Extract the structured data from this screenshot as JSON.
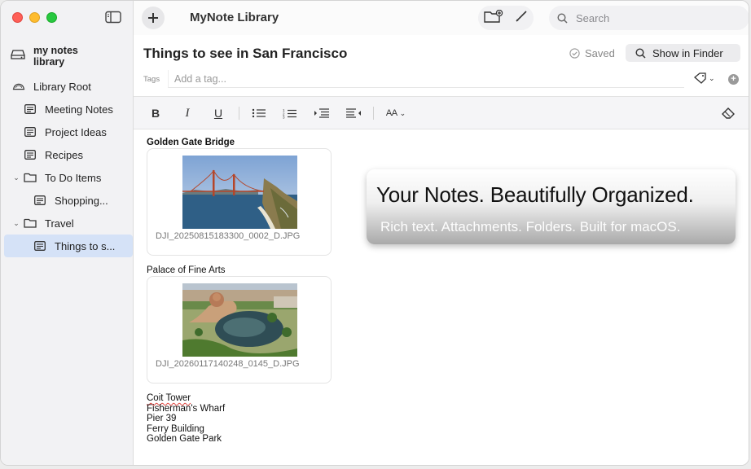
{
  "window": {
    "app_title": "MyNote Library"
  },
  "sidebar": {
    "library_label": "my notes library",
    "items": [
      {
        "label": "Library Root"
      },
      {
        "label": "Meeting Notes"
      },
      {
        "label": "Project Ideas"
      },
      {
        "label": "Recipes"
      },
      {
        "label": "To Do Items"
      },
      {
        "label": "Shopping..."
      },
      {
        "label": "Travel"
      },
      {
        "label": "Things to s..."
      }
    ]
  },
  "toolbar": {
    "search_placeholder": "Search"
  },
  "note": {
    "title": "Things to see in San Francisco",
    "status": "Saved",
    "show_in_finder": "Show in Finder",
    "tags_label": "Tags",
    "tag_placeholder": "Add a tag..."
  },
  "format_bar": {
    "bold": "B",
    "italic": "I",
    "underline": "U",
    "font_size": "AA"
  },
  "content": {
    "section1_title": "Golden Gate Bridge",
    "attachment1_name": "DJI_20250815183300_0002_D.JPG",
    "section2_title": "Palace of Fine Arts",
    "attachment2_name": "DJI_20260117140248_0145_D.JPG",
    "list": [
      "Coit Tower",
      "Fisherman's Wharf",
      "Pier 39",
      "Ferry Building",
      "Golden Gate Park"
    ]
  },
  "banner": {
    "headline": "Your Notes. Beautifully Organized.",
    "subline": "Rich text. Attachments. Folders. Built for macOS."
  },
  "colors": {
    "selection": "#d5e2f7",
    "close": "#fe5f57",
    "minimize": "#febc2e",
    "zoom": "#28c840"
  }
}
